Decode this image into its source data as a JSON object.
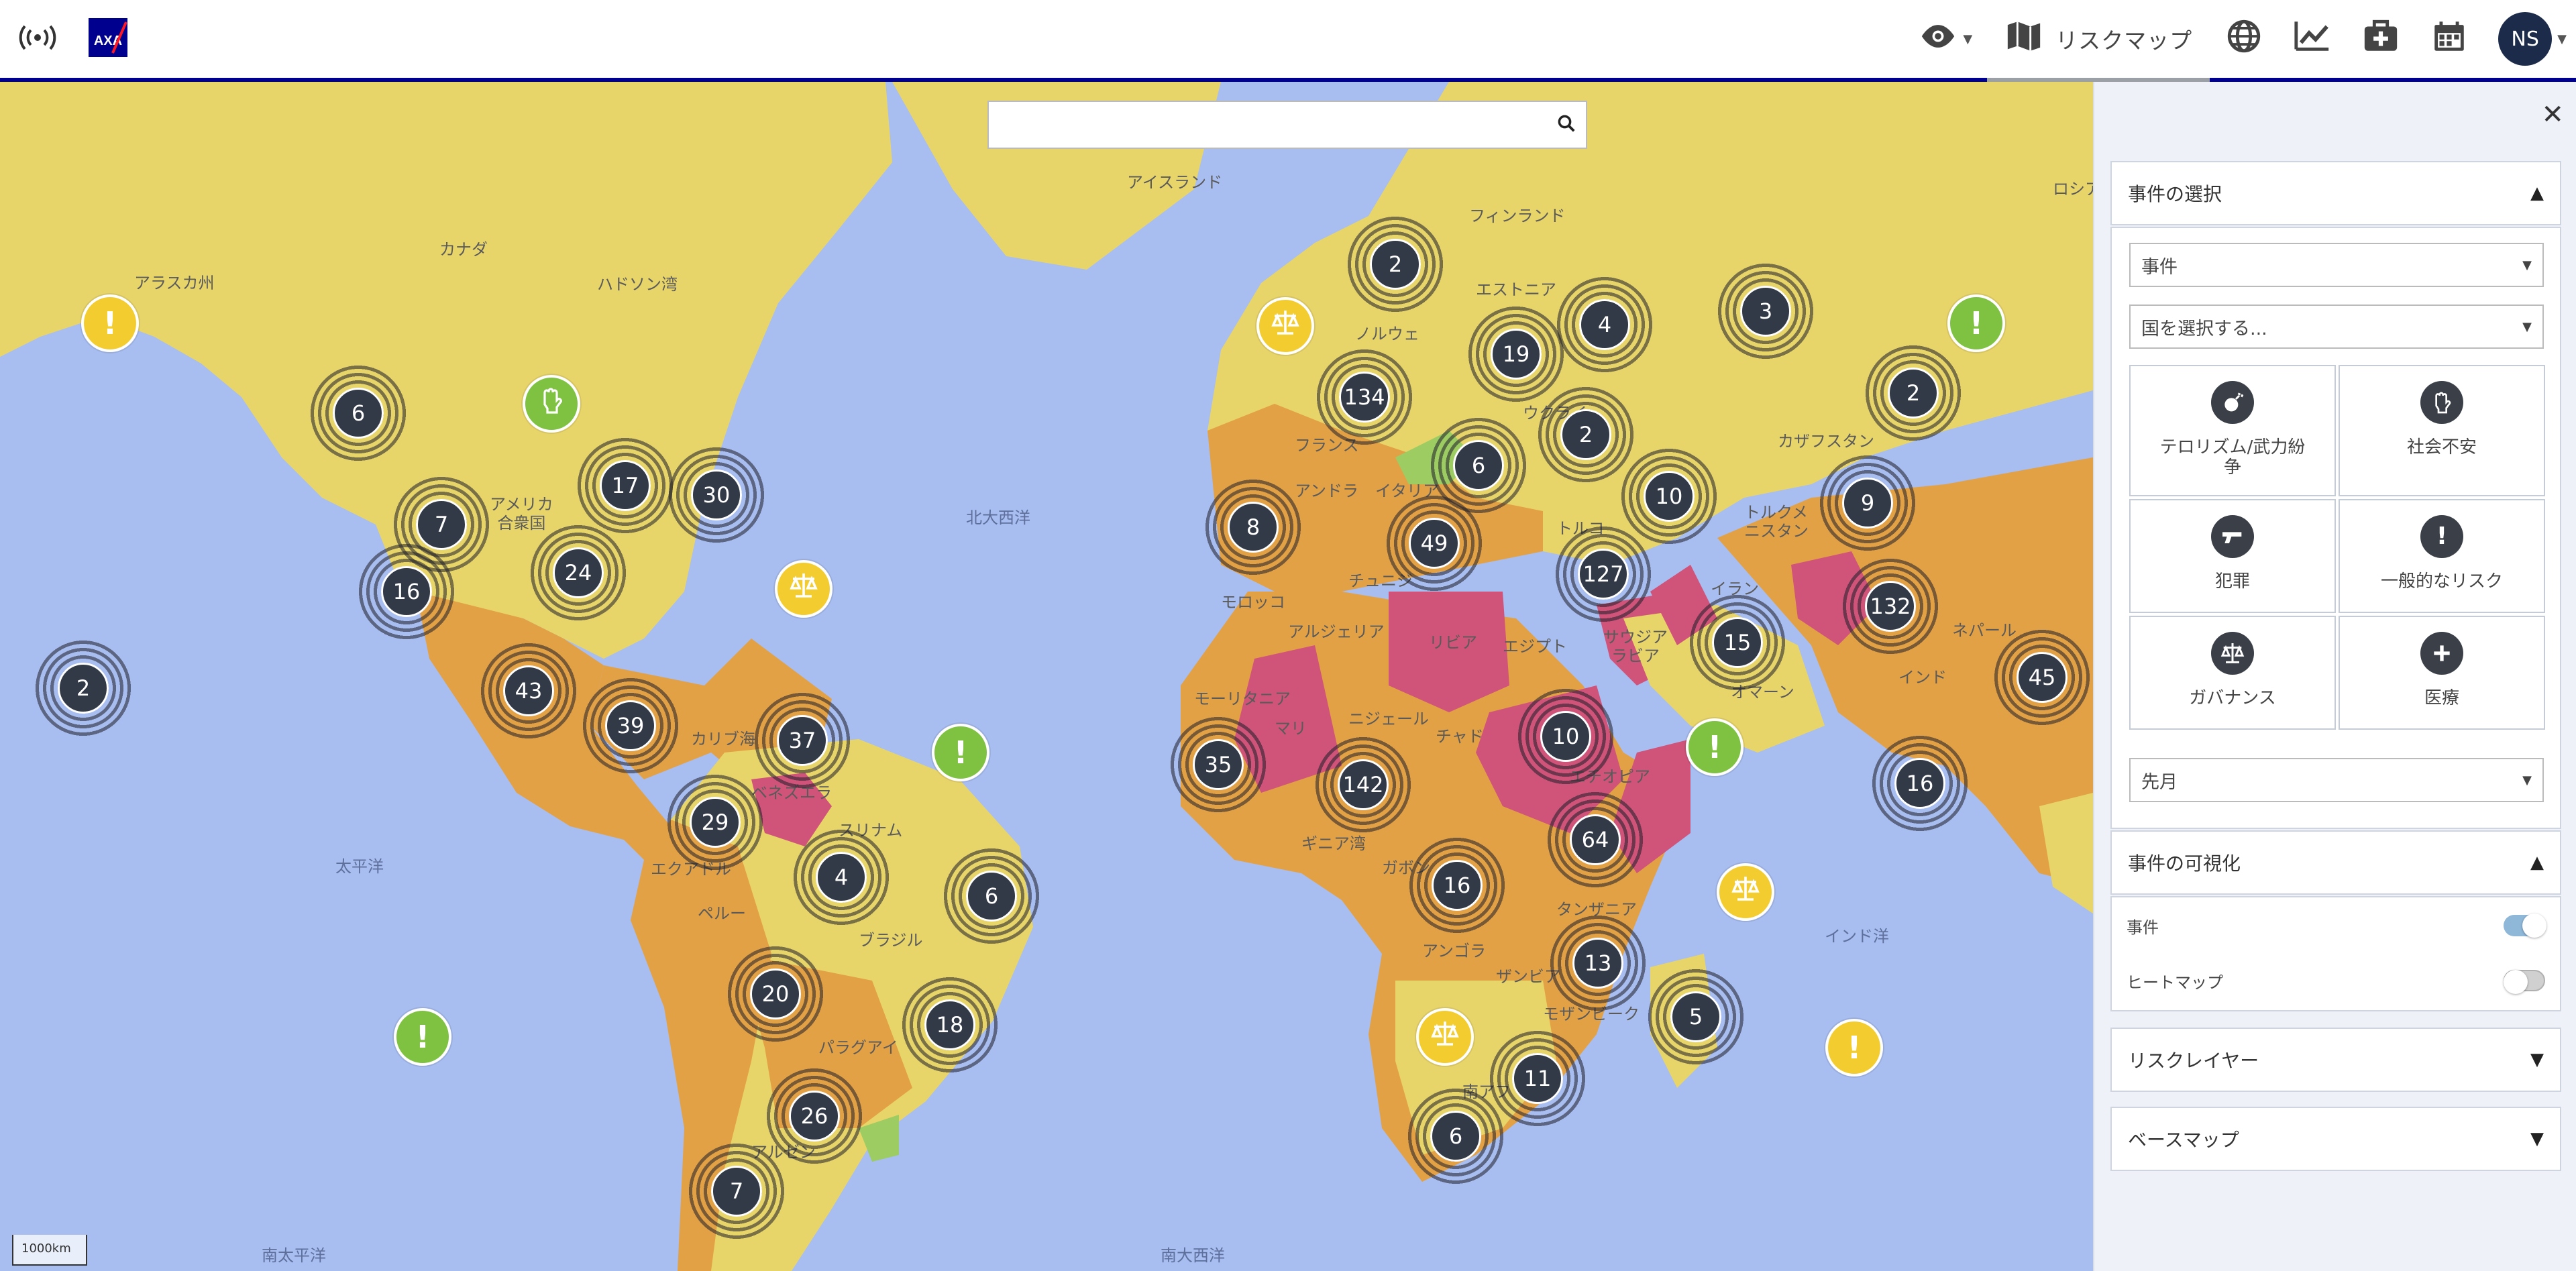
{
  "header": {
    "risk_map_label": "リスクマップ",
    "user_initials": "NS"
  },
  "search": {
    "placeholder": ""
  },
  "map_labels": {
    "canada": "カナダ",
    "alaska": "アラスカ州",
    "hudson_bay": "ハドソン湾",
    "usa": "アメリカ\n合衆国",
    "north_atlantic": "北大西洋",
    "caribbean": "カリブ海",
    "south_atlantic": "南大西洋",
    "pacific": "太平洋",
    "south_pacific": "南太平洋",
    "iceland": "アイスランド",
    "finland": "フィンランド",
    "estonia": "エストニア",
    "france": "フランス",
    "spain": "アンドラ",
    "italy": "イタリア",
    "ukraine": "ウクライ",
    "turkey": "トルコ",
    "kazakhstan": "カザフスタン",
    "turkmenistan": "トルクメ\nニスタン",
    "iran": "イラン",
    "saudi": "サウジア\nラビア",
    "oman": "オマーン",
    "nepal": "ネパール",
    "india": "インド",
    "indian_ocean": "インド洋",
    "morocco": "モロッコ",
    "algeria": "アルジェリア",
    "libya": "リビア",
    "egypt": "エジプト",
    "tunisia": "チュニジ",
    "mauritania": "モーリタニア",
    "mali": "マリ",
    "niger": "ニジェール",
    "chad": "チャド",
    "ethiopia": "エチオピア",
    "tanzania": "タンザニア",
    "angola": "アンゴラ",
    "zambia": "ザンビア",
    "mozambique": "モザンビーク",
    "south_africa": "南アフ",
    "brazil": "ブラジル",
    "peru": "ペルー",
    "paraguay": "パラグアイ",
    "venezuela": "ベネズエラ",
    "suriname": "スリナム",
    "ecuador": "エクアドル",
    "gabon": "ガボン",
    "argentina": "アルゼン",
    "guinea": "ギニア湾",
    "sweden": "ノルウェ",
    "russia": "ロシア"
  },
  "clusters": [
    {
      "count": "6"
    },
    {
      "count": "7"
    },
    {
      "count": "17"
    },
    {
      "count": "30"
    },
    {
      "count": "16"
    },
    {
      "count": "24"
    },
    {
      "count": "2"
    },
    {
      "count": "43"
    },
    {
      "count": "39"
    },
    {
      "count": "37"
    },
    {
      "count": "29"
    },
    {
      "count": "4"
    },
    {
      "count": "6"
    },
    {
      "count": "20"
    },
    {
      "count": "18"
    },
    {
      "count": "26"
    },
    {
      "count": "7"
    },
    {
      "count": "2"
    },
    {
      "count": "134"
    },
    {
      "count": "19"
    },
    {
      "count": "4"
    },
    {
      "count": "3"
    },
    {
      "count": "2"
    },
    {
      "count": "2"
    },
    {
      "count": "6"
    },
    {
      "count": "10"
    },
    {
      "count": "9"
    },
    {
      "count": "8"
    },
    {
      "count": "49"
    },
    {
      "count": "127"
    },
    {
      "count": "132"
    },
    {
      "count": "15"
    },
    {
      "count": "45"
    },
    {
      "count": "10"
    },
    {
      "count": "35"
    },
    {
      "count": "142"
    },
    {
      "count": "16"
    },
    {
      "count": "64"
    },
    {
      "count": "16"
    },
    {
      "count": "13"
    },
    {
      "count": "5"
    },
    {
      "count": "11"
    },
    {
      "count": "6"
    }
  ],
  "scale_label": "1000km",
  "panel": {
    "section1_title": "事件の選択",
    "incident_select": "事件",
    "country_select": "国を選択する...",
    "categories": [
      {
        "label": "テロリズム/武力紛争",
        "icon": "bomb-icon"
      },
      {
        "label": "社会不安",
        "icon": "raised-fist-icon"
      },
      {
        "label": "犯罪",
        "icon": "gun-icon"
      },
      {
        "label": "一般的なリスク",
        "icon": "exclamation-icon"
      },
      {
        "label": "ガバナンス",
        "icon": "scales-icon"
      },
      {
        "label": "医療",
        "icon": "plus-icon"
      }
    ],
    "period_select": "先月",
    "section2_title": "事件の可視化",
    "toggle_incidents": "事件",
    "toggle_heatmap": "ヒートマップ",
    "incidents_on": true,
    "heatmap_on": false,
    "section3_title": "リスクレイヤー",
    "section4_title": "ベースマップ"
  },
  "colors": {
    "brand_blue": "#00008f",
    "ocean": "#a8bdf0",
    "low_risk": "#e8d56a",
    "medium_risk": "#e3a145",
    "high_risk": "#d0547a",
    "minimal_risk": "#9ccc62"
  }
}
